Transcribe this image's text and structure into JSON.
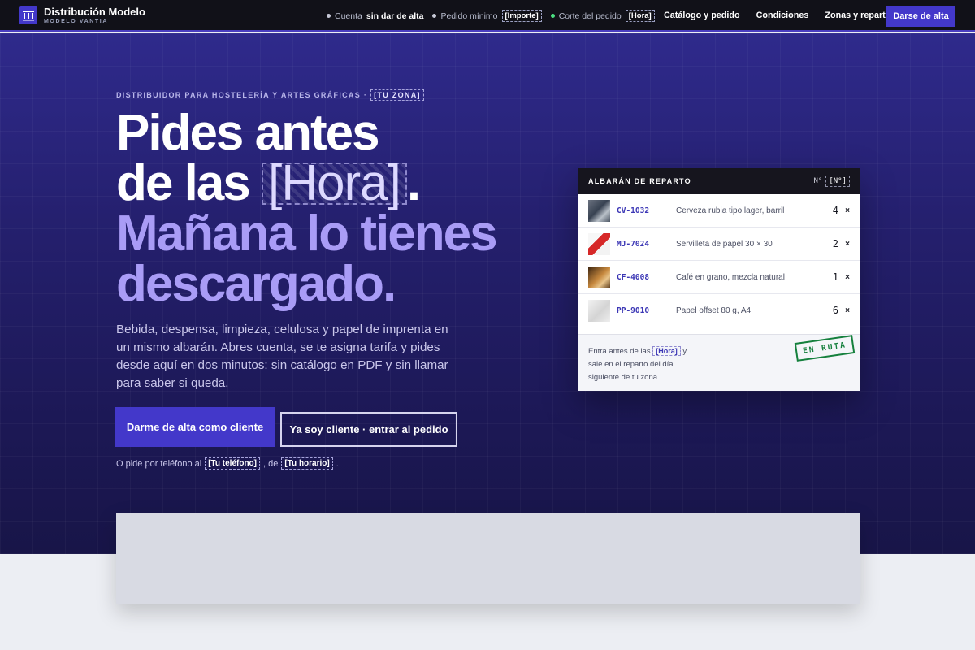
{
  "header": {
    "brand_name": "Distribución Modelo",
    "brand_sub": "MODELO VANTIA",
    "logo_icon": "columns-building-icon",
    "status": [
      {
        "label": "Cuenta",
        "value": "sin dar de alta",
        "placeholder": false,
        "dot": "#c6c8d6"
      },
      {
        "label": "Pedido mínimo",
        "value": "[Importe]",
        "placeholder": true,
        "dot": "#c6c8d6"
      },
      {
        "label": "Corte del pedido",
        "value": "[Hora]",
        "placeholder": true,
        "dot": "#4ade80"
      }
    ],
    "nav": [
      "Catálogo y pedido",
      "Condiciones",
      "Zonas y reparto"
    ],
    "cta": "Darse de alta"
  },
  "hero": {
    "eyebrow": "DISTRIBUIDOR PARA HOSTELERÍA Y ARTES GRÁFICAS ·",
    "eyebrow_placeholder": "[TU ZONA]",
    "headline_line1": "Pides antes",
    "headline_line2_pre": "de las ",
    "headline_line2_ph": "[Hora]",
    "headline_line2_post": ".",
    "headline_line3": "Mañana lo tienes",
    "headline_line4": "descargado.",
    "lede": "Bebida, despensa, limpieza, celulosa y papel de imprenta en un mismo albarán. Abres cuenta, se te asigna tarifa y pides desde aquí en dos minutos: sin catálogo en PDF y sin llamar para saber si queda.",
    "primary_button": "Darme de alta como cliente",
    "secondary_button": "Ya soy cliente · entrar al pedido",
    "phone_pre": "O pide por teléfono al",
    "phone_ph": "[Tu teléfono]",
    "phone_mid": ", de",
    "phone_hours_ph": "[Tu horario]",
    "phone_post": "."
  },
  "albaran": {
    "title": "ALBARÁN DE REPARTO",
    "number_label": "N°",
    "number_ph": "[N°]",
    "items": [
      {
        "code": "CV-1032",
        "description": "Cerveza rubia tipo lager, barril",
        "qty": "4",
        "unit": "×",
        "thumb": "beer-keg-thumb"
      },
      {
        "code": "MJ-7024",
        "description": "Servilleta de papel 30 × 30",
        "qty": "2",
        "unit": "×",
        "thumb": "napkin-thumb"
      },
      {
        "code": "CF-4008",
        "description": "Café en grano, mezcla natural",
        "qty": "1",
        "unit": "×",
        "thumb": "coffee-thumb"
      },
      {
        "code": "PP-9010",
        "description": "Papel offset 80 g, A4",
        "qty": "6",
        "unit": "×",
        "thumb": "paper-thumb"
      }
    ],
    "footer_pre": "Entra antes de las",
    "footer_ph": "[Hora]",
    "footer_post": "y sale en el reparto del día siguiente de tu zona.",
    "stamp": "EN RUTA"
  },
  "colors": {
    "accent": "#4338ca",
    "headline_lavender": "#a99cf6",
    "hero_bg": "#25206f",
    "stamp_green": "#15803d"
  }
}
